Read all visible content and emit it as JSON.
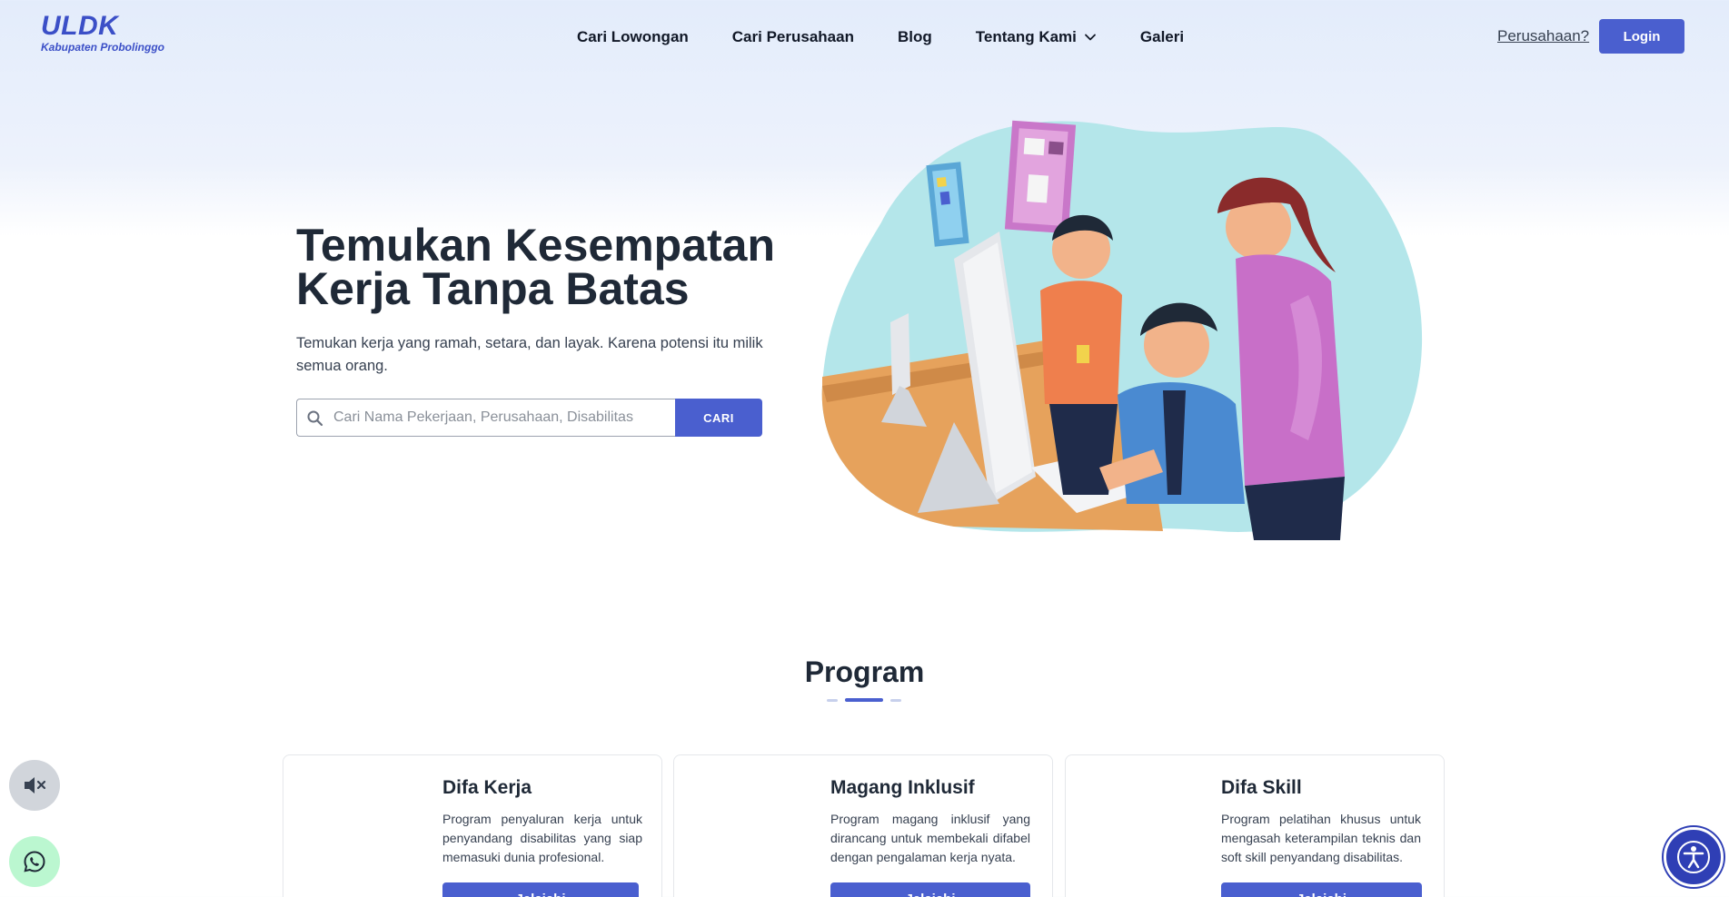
{
  "header": {
    "logo_title": "ULDK",
    "logo_subtitle": "Kabupaten Probolinggo",
    "nav": [
      {
        "label": "Cari Lowongan"
      },
      {
        "label": "Cari Perusahaan"
      },
      {
        "label": "Blog"
      },
      {
        "label": "Tentang Kami",
        "icon": "chevron-down-icon"
      },
      {
        "label": "Galeri"
      }
    ],
    "company_link": "Perusahaan?",
    "login_label": "Login"
  },
  "hero": {
    "title_line1": "Temukan Kesempatan",
    "title_line2": "Kerja Tanpa Batas",
    "subtitle": "Temukan kerja yang ramah, setara, dan layak. Karena potensi itu milik semua orang.",
    "search": {
      "placeholder": "Cari Nama Pekerjaan, Perusahaan, Disabilitas",
      "value": "",
      "button_label": "CARI",
      "icon": "search-icon"
    },
    "illustration": "office-team-illustration"
  },
  "program": {
    "title": "Program",
    "cards": [
      {
        "title": "Difa Kerja",
        "description": "Program penyaluran kerja untuk penyandang disabilitas yang siap memasuki dunia profesional.",
        "button_label": "Jelajahi"
      },
      {
        "title": "Magang Inklusif",
        "description": "Program magang inklusif yang dirancang untuk membekali difabel dengan pengalaman kerja nyata.",
        "button_label": "Jelajahi"
      },
      {
        "title": "Difa Skill",
        "description": "Program pelatihan khusus untuk mengasah keterampilan teknis dan soft skill penyandang disabilitas.",
        "button_label": "Jelajahi"
      }
    ]
  },
  "floating": {
    "mute_icon": "speaker-muted-icon",
    "whatsapp_icon": "whatsapp-icon",
    "accessibility_icon": "accessibility-icon"
  },
  "colors": {
    "primary": "#4a5fcf",
    "logo": "#3b4fc7",
    "text_dark": "#1f2937",
    "accessibility": "#2f3fb5"
  }
}
